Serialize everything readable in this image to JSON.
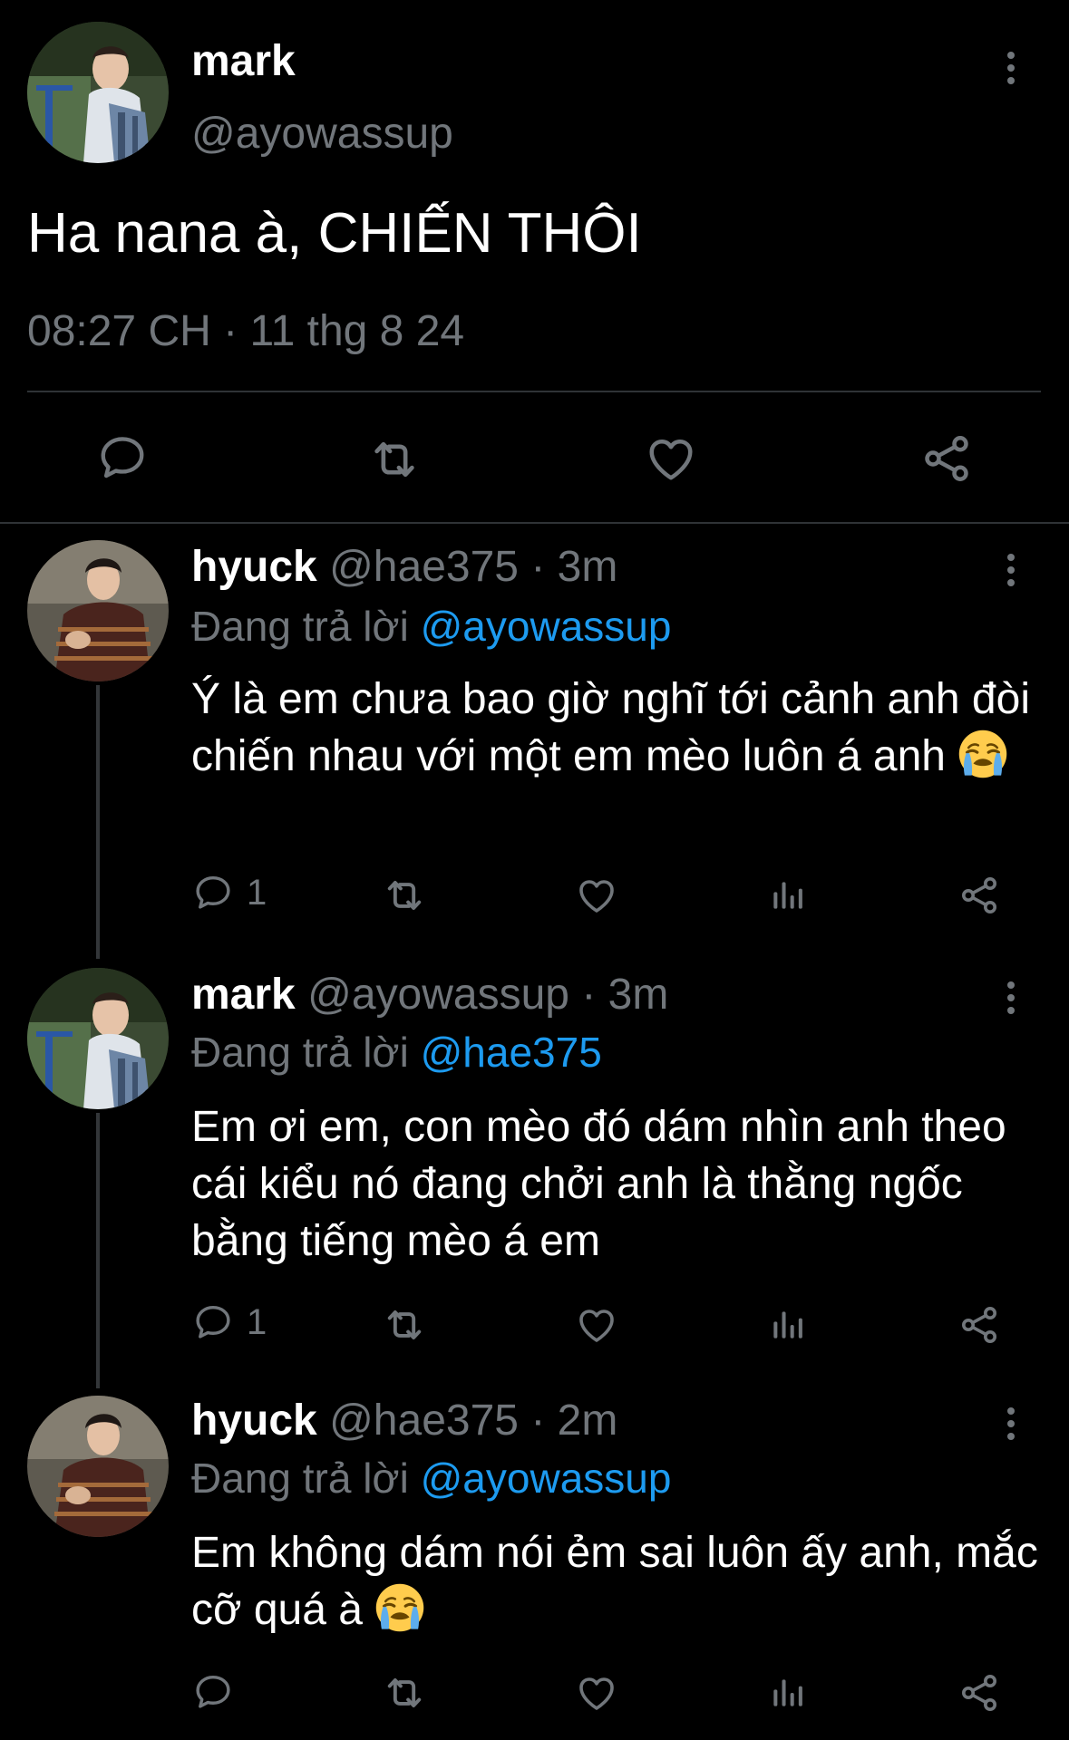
{
  "main_tweet": {
    "author": "mark",
    "handle": "@ayowassup",
    "text": "Ha nana à, CHIẾN THÔI",
    "time": "08:27 CH",
    "sep": "·",
    "date": "11 thg 8 24"
  },
  "replies": [
    {
      "author": "hyuck",
      "handle": "@hae375",
      "dot": "·",
      "age": "3m",
      "replying_label": "Đang trả lời",
      "replying_to": "@ayowassup",
      "text": "Ý là em chưa bao giờ nghĩ tới cảnh anh đòi chiến nhau với một em mèo luôn á anh",
      "emoji": "loudly-crying-face",
      "reply_count": "1"
    },
    {
      "author": "mark",
      "handle": "@ayowassup",
      "dot": "·",
      "age": "3m",
      "replying_label": "Đang trả lời",
      "replying_to": "@hae375",
      "text": "Em ơi em, con mèo đó dám nhìn anh theo cái kiểu nó đang chởi anh là thằng ngốc bằng tiếng mèo á em",
      "reply_count": "1"
    },
    {
      "author": "hyuck",
      "handle": "@hae375",
      "dot": "·",
      "age": "2m",
      "replying_label": "Đang trả lời",
      "replying_to": "@ayowassup",
      "text": "Em không dám nói ẻm sai luôn ấy anh, mắc cỡ quá à",
      "emoji": "loudly-crying-face",
      "reply_count": ""
    }
  ],
  "icons": [
    "reply-icon",
    "retweet-icon",
    "like-icon",
    "views-icon",
    "share-icon",
    "more-icon"
  ],
  "colors": {
    "background": "#000000",
    "muted": "#71767b",
    "link": "#1d9bf0",
    "divider": "#2f3336"
  }
}
